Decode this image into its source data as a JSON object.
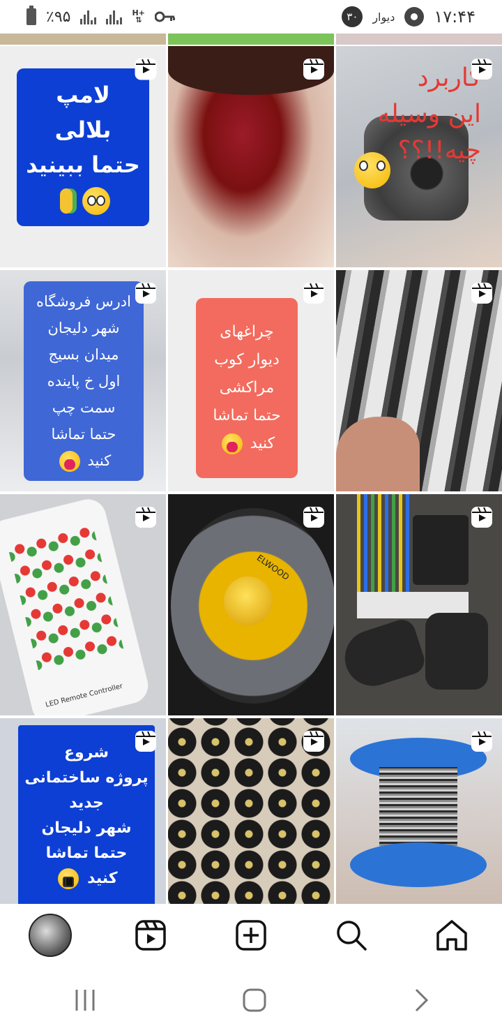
{
  "status_bar": {
    "battery": "٪۹۵",
    "badge": "۳۰",
    "divar": "دیوار",
    "time": "۱۷:۴۴"
  },
  "tiles": [
    {
      "id": "lamp",
      "lines": [
        "لامپ",
        "بلالی",
        "حتما ببینید"
      ],
      "emojis": "😳 🌽",
      "card_color": "#0d3fd4"
    },
    {
      "id": "meat"
    },
    {
      "id": "device",
      "lines": [
        "کاربرد",
        "این وسیله",
        "چیه!!؟؟"
      ],
      "emojis": "😳"
    },
    {
      "id": "address",
      "lines": [
        "ادرس فروشگاه",
        "شهر دلیجان",
        "میدان بسیج",
        "اول خ پاینده",
        "سمت چپ",
        "حتما تماشا",
        "کنید"
      ],
      "emojis": "😍",
      "card_color": "#3f67d6"
    },
    {
      "id": "lamps-wall",
      "lines": [
        "چراغهای",
        "دیوار کوب",
        "مراکشی",
        "حتما تماشا",
        "کنید"
      ],
      "emojis": "😍",
      "card_color": "#f26b5e"
    },
    {
      "id": "led-strip"
    },
    {
      "id": "remote",
      "remote_label": "LED Remote Controller"
    },
    {
      "id": "speaker",
      "brand": "ELWOOD"
    },
    {
      "id": "gate-remote"
    },
    {
      "id": "project",
      "lines": [
        "شروع",
        "پروژه ساختمانی",
        "جدید",
        "شهر دلیجان",
        "حتما تماشا",
        "کنید"
      ],
      "emojis": "😎",
      "card_color": "#0d3fd4"
    },
    {
      "id": "black-fittings"
    },
    {
      "id": "wire-spool"
    }
  ],
  "bottom_nav": [
    "profile",
    "reels",
    "create",
    "search",
    "home"
  ],
  "colors": {
    "accent": "#0d3fd4",
    "text": "#222222"
  }
}
